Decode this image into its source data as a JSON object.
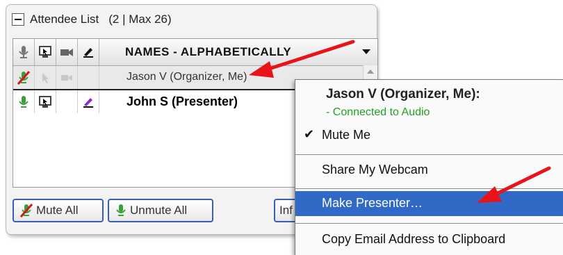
{
  "panel": {
    "title": "Attendee List",
    "count": "(2 | Max 26)",
    "names_header": "NAMES - ALPHABETICALLY",
    "attendees": [
      {
        "name": "Jason V (Organizer, Me)",
        "audio": "muted",
        "bold": false
      },
      {
        "name": "John S (Presenter)",
        "audio": "connected",
        "bold": true
      }
    ],
    "buttons": {
      "mute_all": "Mute All",
      "unmute_all": "Unmute All",
      "info": "Inf"
    }
  },
  "context_menu": {
    "title": "Jason V (Organizer, Me):",
    "status": "- Connected to Audio",
    "items": [
      {
        "label": "Mute Me",
        "checked": true
      },
      {
        "label": "Share My Webcam",
        "checked": false
      },
      {
        "label": "Make Presenter…",
        "highlighted": true
      },
      {
        "label": "Copy Email Address to Clipboard",
        "checked": false
      }
    ]
  },
  "colors": {
    "highlight": "#3169c6",
    "status_green": "#22a022",
    "button_border": "#3a5fb0",
    "arrow_red": "#e8141a"
  }
}
